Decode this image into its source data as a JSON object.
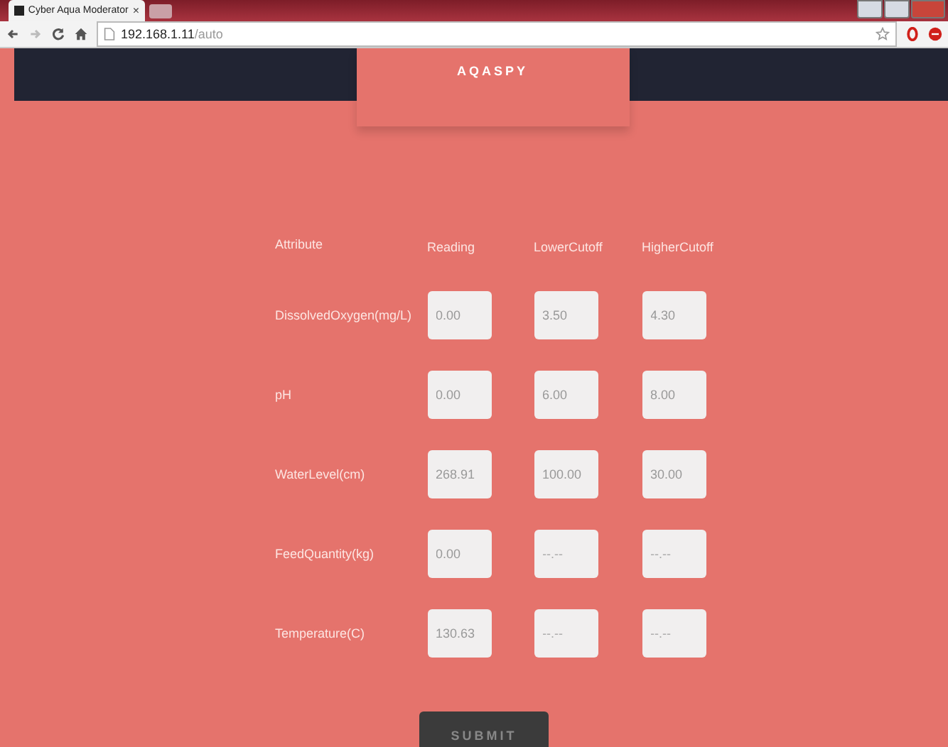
{
  "browser": {
    "tab_title": "Cyber Aqua Moderator",
    "tab_close": "×",
    "url_host": "192.168.1.11",
    "url_path": "/auto"
  },
  "nav": {
    "brand": "AQASPY"
  },
  "table": {
    "columns": [
      "Attribute",
      "Reading",
      "LowerCutoff",
      "HigherCutoff"
    ],
    "rows": [
      {
        "attribute": "DissolvedOxygen(mg/L)",
        "reading": "0.00",
        "lower": {
          "value": "3.50"
        },
        "higher": {
          "value": "4.30"
        }
      },
      {
        "attribute": "pH",
        "reading": "0.00",
        "lower": {
          "value": "6.00"
        },
        "higher": {
          "value": "8.00"
        }
      },
      {
        "attribute": "WaterLevel(cm)",
        "reading": "268.91",
        "lower": {
          "value": "100.00"
        },
        "higher": {
          "value": "30.00"
        }
      },
      {
        "attribute": "FeedQuantity(kg)",
        "reading": "0.00",
        "lower": {
          "placeholder": "--.--"
        },
        "higher": {
          "placeholder": "--.--"
        }
      },
      {
        "attribute": "Temperature(C)",
        "reading": "130.63",
        "lower": {
          "placeholder": "--.--"
        },
        "higher": {
          "placeholder": "--.--"
        }
      }
    ]
  },
  "submit": "SUBMIT"
}
